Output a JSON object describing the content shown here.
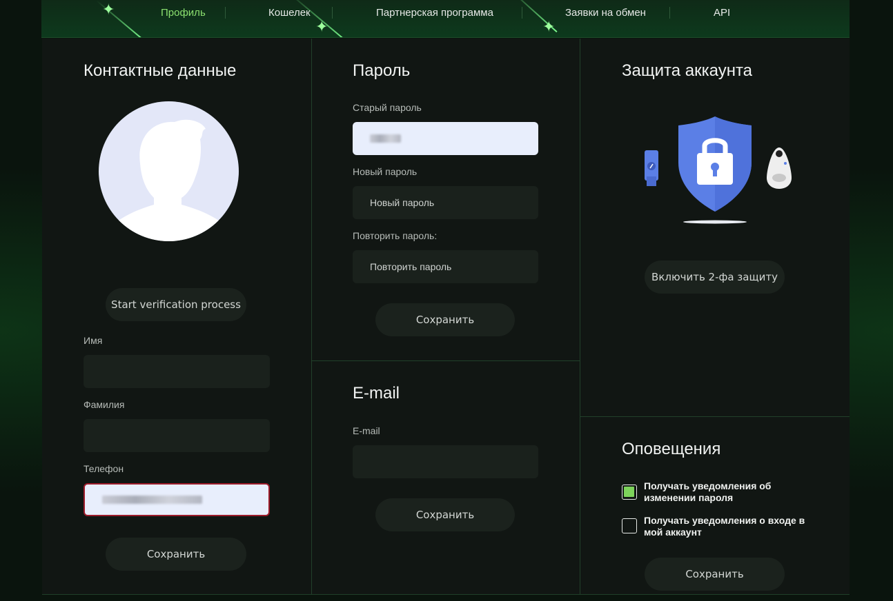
{
  "nav": {
    "items": [
      {
        "label": "Профиль",
        "active": true
      },
      {
        "label": "Кошелек",
        "active": false
      },
      {
        "label": "Партнерская программа",
        "active": false
      },
      {
        "label": "Заявки на обмен",
        "active": false
      },
      {
        "label": "API",
        "active": false
      }
    ]
  },
  "contacts": {
    "title": "Контактные данные",
    "verify_button": "Start verification process",
    "first_name_label": "Имя",
    "last_name_label": "Фамилия",
    "phone_label": "Телефон",
    "save_label": "Сохранить"
  },
  "password": {
    "title": "Пароль",
    "old_label": "Старый пароль",
    "new_label": "Новый пароль",
    "new_placeholder": "Новый пароль",
    "repeat_label": "Повторить пароль:",
    "repeat_placeholder": "Повторить пароль",
    "save_label": "Сохранить"
  },
  "email": {
    "title": "E-mail",
    "field_label": "E-mail",
    "save_label": "Сохранить"
  },
  "security": {
    "title": "Защита аккаунта",
    "enable_2fa_label": "Включить 2-фа защиту"
  },
  "notifications": {
    "title": "Оповещения",
    "options": [
      {
        "label": "Получать уведомления об изменении пароля",
        "checked": true
      },
      {
        "label": "Получать уведомления о входе в мой аккаунт",
        "checked": false
      }
    ],
    "save_label": "Сохранить"
  },
  "colors": {
    "accent_green": "#7dd35b",
    "panel_bg": "#111613",
    "error_border": "#9d1b2a",
    "shield_blue": "#5b7fe6"
  }
}
